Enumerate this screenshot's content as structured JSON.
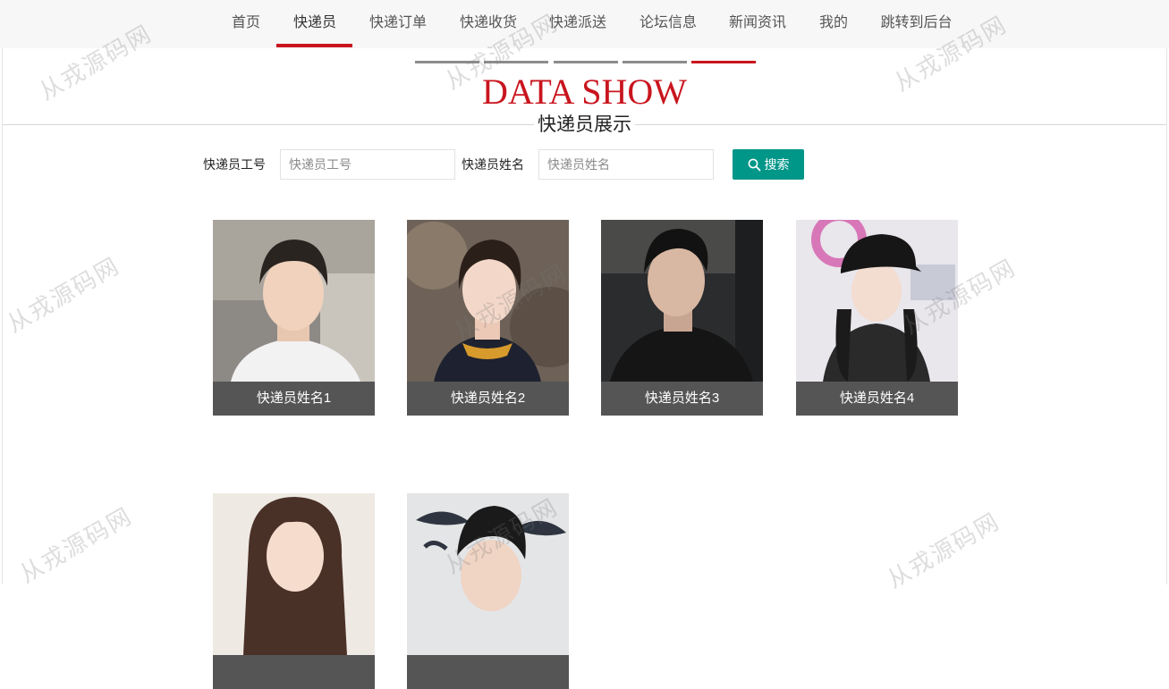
{
  "nav": {
    "items": [
      {
        "label": "首页"
      },
      {
        "label": "快递员"
      },
      {
        "label": "快递订单"
      },
      {
        "label": "快递收货"
      },
      {
        "label": "快递派送"
      },
      {
        "label": "论坛信息"
      },
      {
        "label": "新闻资讯"
      },
      {
        "label": "我的"
      },
      {
        "label": "跳转到后台"
      }
    ],
    "active": "快递员"
  },
  "header": {
    "title_en": "DATA SHOW",
    "title_cn": "快递员展示"
  },
  "search": {
    "field1_label": "快递员工号",
    "field1_placeholder": "快递员工号",
    "field1_value": "",
    "field2_label": "快递员姓名",
    "field2_placeholder": "快递员姓名",
    "field2_value": "",
    "button_label": "搜索",
    "button_color": "#009688"
  },
  "couriers": [
    {
      "name": "快递员姓名1"
    },
    {
      "name": "快递员姓名2"
    },
    {
      "name": "快递员姓名3"
    },
    {
      "name": "快递员姓名4"
    },
    {
      "name": ""
    },
    {
      "name": ""
    }
  ],
  "watermark": "从戎源码网",
  "colors": {
    "accent": "#c9151e",
    "card_label_bg": "#555555"
  }
}
